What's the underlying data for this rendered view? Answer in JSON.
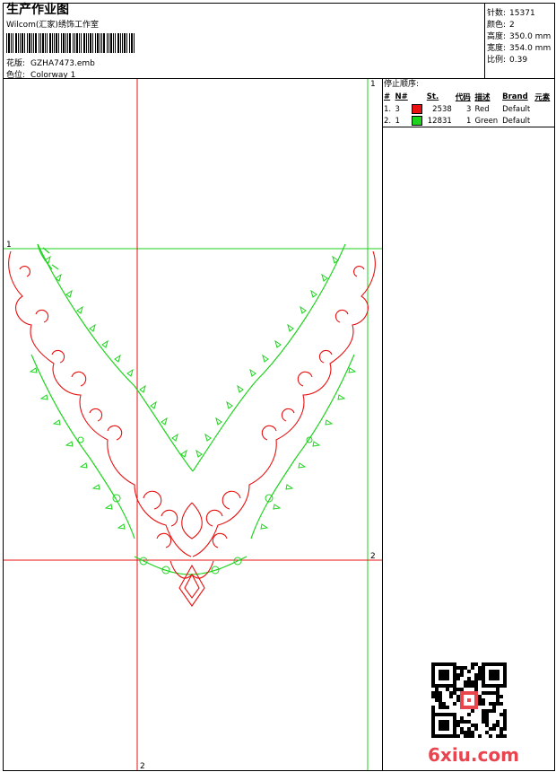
{
  "header": {
    "title": "生产作业图",
    "studio": "Wilcom(汇家)绣饰工作室",
    "design_label": "花版:",
    "design_value": "GZHA7473.emb",
    "colorway_label": "色位:",
    "colorway_value": "Colorway 1"
  },
  "stats": [
    {
      "label": "针数:",
      "value": "15371"
    },
    {
      "label": "颜色:",
      "value": "2"
    },
    {
      "label": "高度:",
      "value": "350.0 mm"
    },
    {
      "label": "宽度:",
      "value": "354.0 mm"
    },
    {
      "label": "比例:",
      "value": "0.39"
    }
  ],
  "color_table": {
    "title": "停止顺序:",
    "headers": [
      "#",
      "N#",
      "",
      "St.",
      "代码",
      "描述",
      "Brand",
      "元素"
    ],
    "rows": [
      {
        "idx": "1.",
        "n": "3",
        "color": "#e81010",
        "stitches": "2538",
        "code": "3",
        "desc": "Red",
        "brand": "Default",
        "element": ""
      },
      {
        "idx": "2.",
        "n": "1",
        "color": "#1ed31e",
        "stitches": "12831",
        "code": "1",
        "desc": "Green",
        "brand": "Default",
        "element": ""
      }
    ]
  },
  "guides": {
    "label_1": "1",
    "label_2": "2",
    "colors": {
      "red": "#e81010",
      "green": "#1ed31e"
    }
  },
  "watermark": "6xiu.com"
}
